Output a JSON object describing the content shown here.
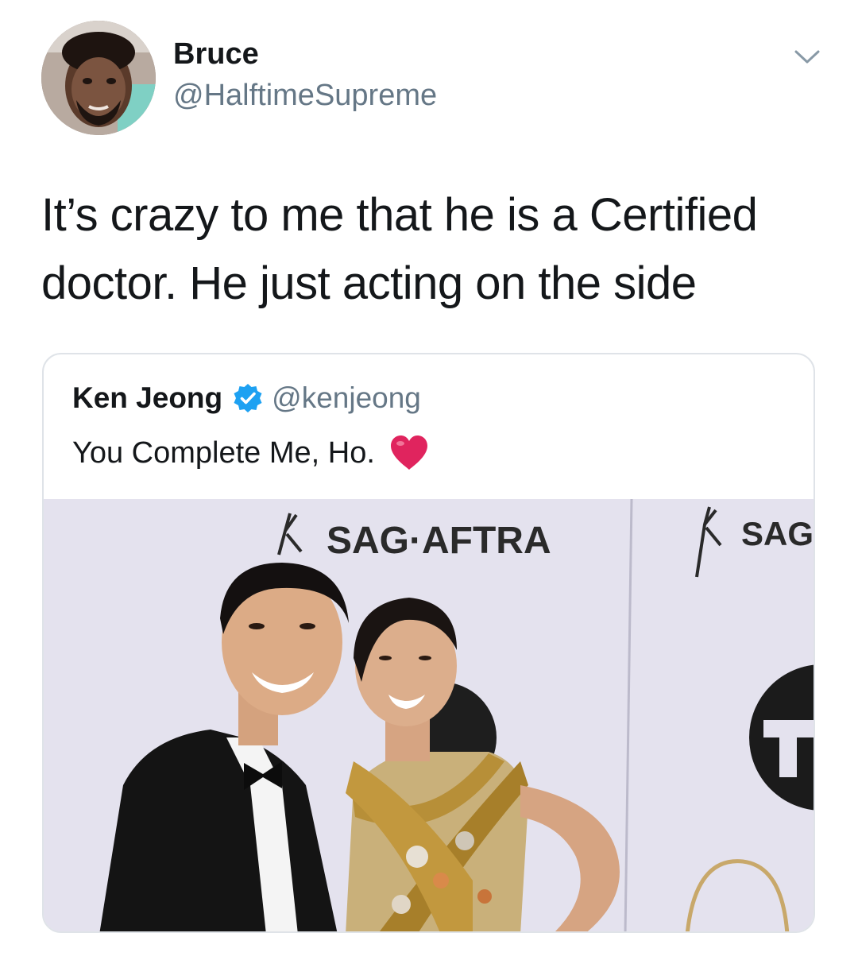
{
  "author": {
    "display_name": "Bruce",
    "handle": "@HalftimeSupreme",
    "avatar_icon": "profile-photo"
  },
  "tweet": {
    "text": "It’s crazy to me that he is a Certified doctor. He just acting on the side"
  },
  "quoted_tweet": {
    "display_name": "Ken Jeong",
    "verified": true,
    "handle": "@kenjeong",
    "text": "You Complete Me, Ho.",
    "emoji": "heart-emoji",
    "photo": {
      "backdrop_text_1": "SAG·AFTRA",
      "backdrop_text_2": "SAG·"
    }
  },
  "colors": {
    "text_primary": "#14171a",
    "text_secondary": "#657786",
    "verified_blue": "#1da1f2",
    "heart_red": "#e0245e",
    "card_border": "#dfe3e8"
  }
}
